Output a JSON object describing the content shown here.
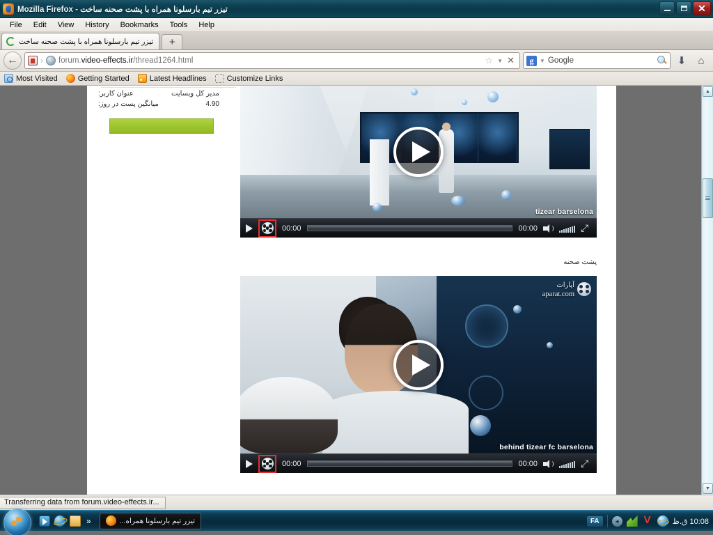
{
  "window": {
    "title": "تیزر تیم بارسلونا همراه با پشت صحنه ساخت - Mozilla Firefox",
    "minimize_label": "Minimize",
    "restore_label": "Restore",
    "close_label": "✕"
  },
  "menubar": {
    "items": [
      {
        "label": "File"
      },
      {
        "label": "Edit"
      },
      {
        "label": "View"
      },
      {
        "label": "History"
      },
      {
        "label": "Bookmarks"
      },
      {
        "label": "Tools"
      },
      {
        "label": "Help"
      }
    ]
  },
  "tabs": {
    "active_title": "تیزر تیم بارسلونا همراه با پشت صحنه ساخت",
    "newtab_label": "+"
  },
  "navbar": {
    "back_label": "←",
    "url_prefix": "forum.",
    "url_domain": "video-effects.ir",
    "url_path": "/thread1264.html",
    "full_url": "forum.video-effects.ir/thread1264.html",
    "star_label": "☆",
    "caret_label": "▼",
    "stop_label": "✕",
    "search_engine": "Google",
    "search_engine_badge": "g",
    "download_label": "⬇",
    "home_label": "⌂"
  },
  "bookmarks": {
    "items": [
      {
        "label": "Most Visited",
        "icon": "most-visited-icon"
      },
      {
        "label": "Getting Started",
        "icon": "firefox-icon"
      },
      {
        "label": "Latest Headlines",
        "icon": "rss-icon"
      },
      {
        "label": "Customize Links",
        "icon": "dashed-placeholder-icon"
      }
    ]
  },
  "page": {
    "sidebar": {
      "rows": [
        {
          "label": "عنوان کاربر:",
          "value": "مدیر کل وبسایت"
        },
        {
          "label": "میانگین پست در روز:",
          "value": "4.90"
        }
      ],
      "green_button_label": ""
    },
    "between_videos_text": "پشت صحنه",
    "videos": [
      {
        "caption": "tizear barselona",
        "current_time": "00:00",
        "duration": "00:00",
        "play_label": "▶",
        "has_watermark": false,
        "reel_highlight_color": "#e03030"
      },
      {
        "caption": "behind tizear fc barselona",
        "current_time": "00:00",
        "duration": "00:00",
        "play_label": "▶",
        "has_watermark": true,
        "watermark_fa": "آپارات",
        "watermark_en": "aparat.com",
        "reel_highlight_color": "#e03030"
      }
    ]
  },
  "statusbar": {
    "text": "Transferring data from forum.video-effects.ir..."
  },
  "taskbar": {
    "start_label": "Start",
    "quicklaunch_more": "»",
    "task_label": "تیزر تیم بارسلونا همراه...",
    "tray": {
      "language": "FA",
      "expand_label": "◄",
      "clock": "10:08 ق.ظ"
    }
  }
}
